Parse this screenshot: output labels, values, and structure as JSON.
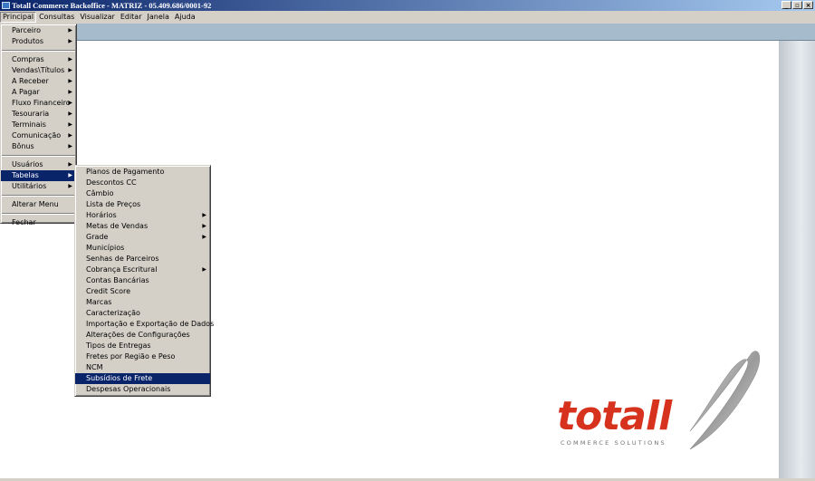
{
  "window": {
    "title": "Totall Commerce Backoffice - MATRIZ  - 05.409.686/0001-92",
    "controls": {
      "minimize": "_",
      "restore": "▫",
      "close": "×"
    }
  },
  "menubar": {
    "items": [
      "Principal",
      "Consultas",
      "Visualizar",
      "Editar",
      "Janela",
      "Ajuda"
    ]
  },
  "principal_menu": {
    "items": [
      {
        "label": "Parceiro",
        "submenu": true
      },
      {
        "label": "Produtos",
        "submenu": true
      },
      {
        "label": "Compras",
        "submenu": true
      },
      {
        "label": "Vendas\\Títulos",
        "submenu": true
      },
      {
        "label": "A Receber",
        "submenu": true
      },
      {
        "label": "A Pagar",
        "submenu": true
      },
      {
        "label": "Fluxo Financeiro",
        "submenu": true
      },
      {
        "label": "Tesouraria",
        "submenu": true
      },
      {
        "label": "Terminais",
        "submenu": true
      },
      {
        "label": "Comunicação",
        "submenu": true
      },
      {
        "label": "Bônus",
        "submenu": true
      },
      {
        "label": "Usuários",
        "submenu": true
      },
      {
        "label": "Tabelas",
        "submenu": true
      },
      {
        "label": "Utilitários",
        "submenu": true
      },
      {
        "label": "Alterar Menu",
        "submenu": false
      },
      {
        "label": "Fechar",
        "submenu": false
      }
    ]
  },
  "tabelas_menu": {
    "items": [
      {
        "label": "Planos de Pagamento"
      },
      {
        "label": "Descontos CC"
      },
      {
        "label": "Câmbio"
      },
      {
        "label": "Lista de Preços"
      },
      {
        "label": "Horários",
        "submenu": true
      },
      {
        "label": "Metas de Vendas",
        "submenu": true
      },
      {
        "label": "Grade",
        "submenu": true
      },
      {
        "label": "Municípios"
      },
      {
        "label": "Senhas de Parceiros"
      },
      {
        "label": "Cobrança Escritural",
        "submenu": true
      },
      {
        "label": "Contas Bancárias"
      },
      {
        "label": "Credit Score"
      },
      {
        "label": "Marcas"
      },
      {
        "label": "Caracterização"
      },
      {
        "label": "Importação e Exportação de Dados"
      },
      {
        "label": "Alterações de Configurações"
      },
      {
        "label": "Tipos de Entregas"
      },
      {
        "label": "Fretes por Região e Peso"
      },
      {
        "label": "NCM"
      },
      {
        "label": "Subsídios de Frete"
      },
      {
        "label": "Despesas Operacionais"
      }
    ]
  },
  "logo": {
    "word": "totall",
    "tagline": "COMMERCE SOLUTIONS"
  },
  "colors": {
    "selection": "#0a246a",
    "logo_red": "#d7321e",
    "workspace_strip": "#a6bccd"
  },
  "icons": {
    "submenu_arrow": "▶"
  }
}
